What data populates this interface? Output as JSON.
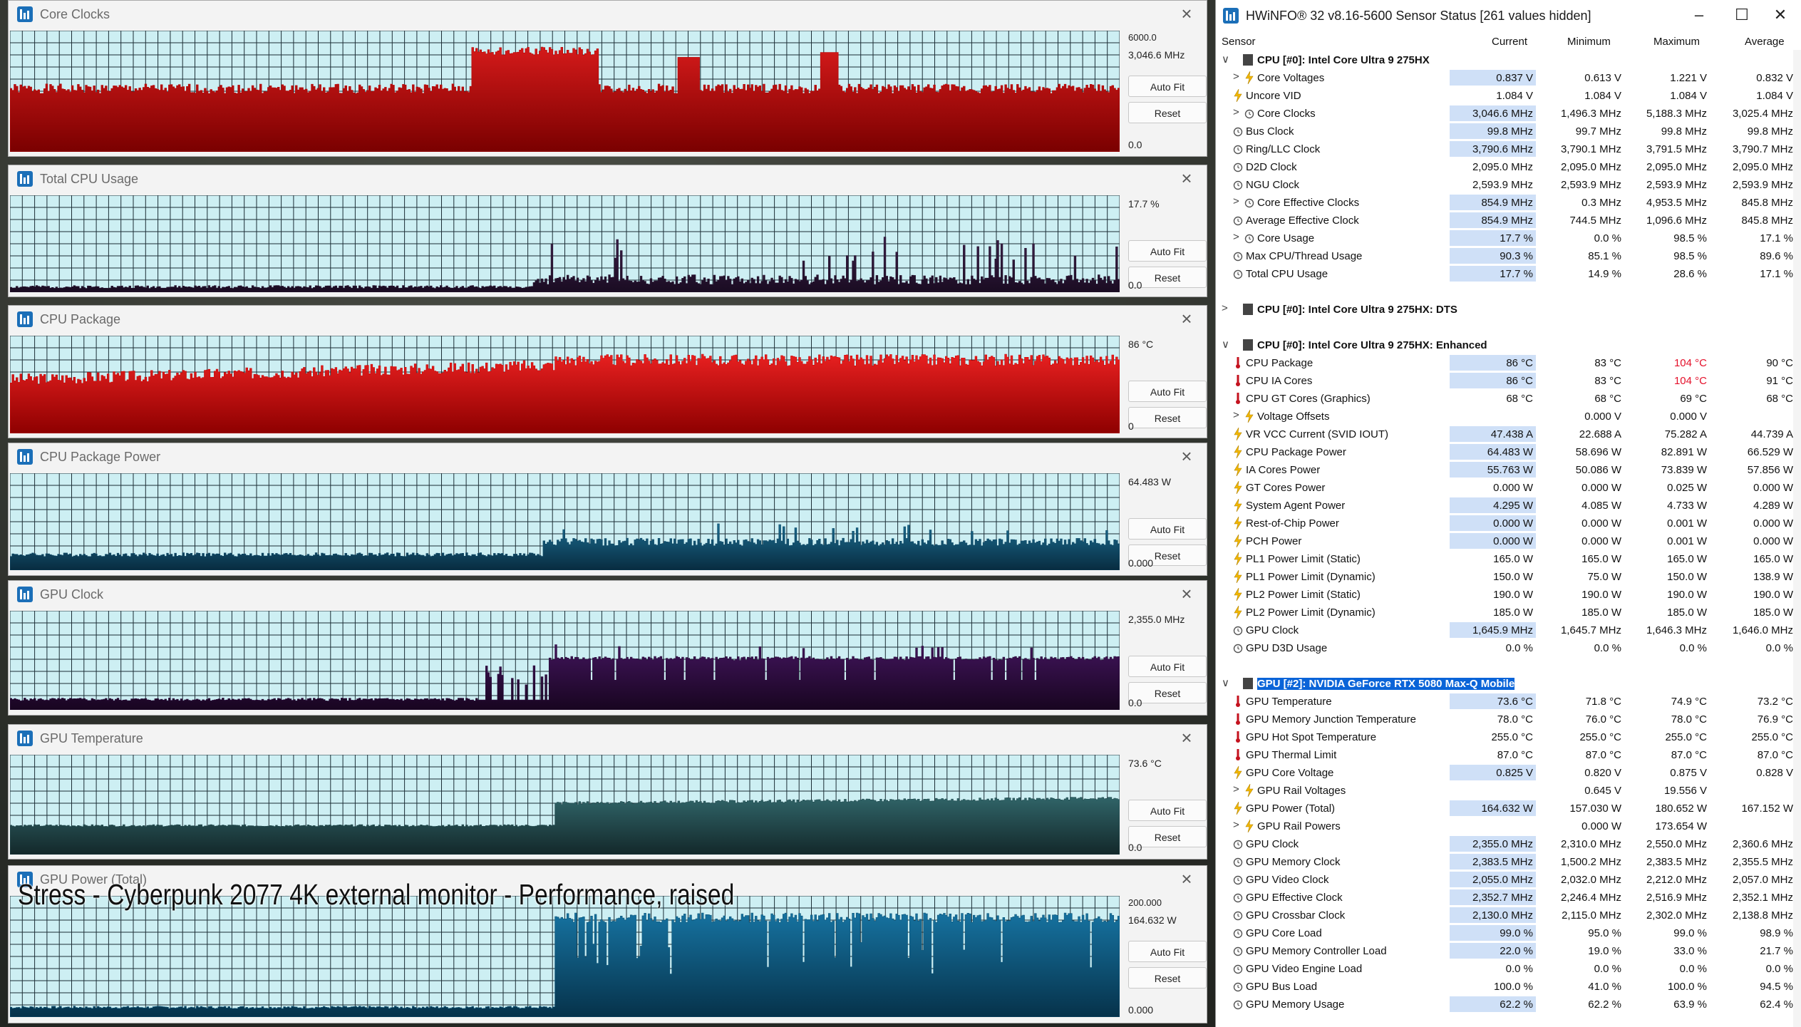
{
  "graphs": [
    {
      "title": "Core Clocks",
      "scale_top": "6000.0",
      "current": "3,046.6 MHz",
      "min": "0.0",
      "colors": [
        "#b80000",
        "#d41a1a",
        "#7a0000"
      ],
      "seed": 1,
      "profile": "clocks"
    },
    {
      "title": "Total CPU Usage",
      "scale_top": "",
      "current": "17.7 %",
      "min": "0.0",
      "colors": [
        "#2a1632",
        "#3a1e48",
        "#1a0c22"
      ],
      "seed": 2,
      "profile": "usage"
    },
    {
      "title": "CPU Package",
      "scale_top": "",
      "current": "86 °C",
      "min": "0",
      "colors": [
        "#d10000",
        "#e82020",
        "#8e0000"
      ],
      "seed": 3,
      "profile": "temp"
    },
    {
      "title": "CPU Package Power",
      "scale_top": "",
      "current": "64.483 W",
      "min": "0.000",
      "colors": [
        "#0f4a68",
        "#1a6a8e",
        "#082c40"
      ],
      "seed": 4,
      "profile": "power"
    },
    {
      "title": "GPU Clock",
      "scale_top": "",
      "current": "2,355.0 MHz",
      "min": "0.0",
      "colors": [
        "#2c0c3c",
        "#40145a",
        "#180520"
      ],
      "seed": 5,
      "profile": "gpuclock"
    },
    {
      "title": "GPU Temperature",
      "scale_top": "",
      "current": "73.6 °C",
      "min": "0.0",
      "colors": [
        "#234c50",
        "#306468",
        "#13282a"
      ],
      "seed": 6,
      "profile": "gputemp"
    },
    {
      "title": "GPU Power (Total)",
      "scale_top": "200.000",
      "current": "164.632 W",
      "min": "0.000",
      "colors": [
        "#0b5478",
        "#1672a0",
        "#06324a"
      ],
      "seed": 7,
      "profile": "gpupower"
    }
  ],
  "buttons": {
    "autofit": "Auto Fit",
    "reset": "Reset"
  },
  "caption": "Stress - Cyberpunk 2077 4K external monitor - Performance, raised",
  "sensor_window": {
    "title": "HWiNFO® 32 v8.16-5600 Sensor Status [261 values hidden]",
    "columns": [
      "Sensor",
      "Current",
      "Minimum",
      "Maximum",
      "Average"
    ],
    "rows": [
      {
        "type": "group",
        "name": "CPU [#0]: Intel Core Ultra 9 275HX",
        "expanded": true
      },
      {
        "type": "item",
        "icon": "bolt",
        "sub": true,
        "name": "Core Voltages",
        "cur": "0.837 V",
        "min": "0.613 V",
        "max": "1.221 V",
        "avg": "0.832 V",
        "hl": true
      },
      {
        "type": "item",
        "icon": "bolt",
        "name": "Uncore VID",
        "cur": "1.084 V",
        "min": "1.084 V",
        "max": "1.084 V",
        "avg": "1.084 V"
      },
      {
        "type": "item",
        "icon": "clock",
        "sub": true,
        "name": "Core Clocks",
        "cur": "3,046.6 MHz",
        "min": "1,496.3 MHz",
        "max": "5,188.3 MHz",
        "avg": "3,025.4 MHz",
        "hl": true
      },
      {
        "type": "item",
        "icon": "clock",
        "name": "Bus Clock",
        "cur": "99.8 MHz",
        "min": "99.7 MHz",
        "max": "99.8 MHz",
        "avg": "99.8 MHz",
        "hl": true
      },
      {
        "type": "item",
        "icon": "clock",
        "name": "Ring/LLC Clock",
        "cur": "3,790.6 MHz",
        "min": "3,790.1 MHz",
        "max": "3,791.5 MHz",
        "avg": "3,790.7 MHz",
        "hl": true
      },
      {
        "type": "item",
        "icon": "clock",
        "name": "D2D Clock",
        "cur": "2,095.0 MHz",
        "min": "2,095.0 MHz",
        "max": "2,095.0 MHz",
        "avg": "2,095.0 MHz"
      },
      {
        "type": "item",
        "icon": "clock",
        "name": "NGU Clock",
        "cur": "2,593.9 MHz",
        "min": "2,593.9 MHz",
        "max": "2,593.9 MHz",
        "avg": "2,593.9 MHz"
      },
      {
        "type": "item",
        "icon": "clock",
        "sub": true,
        "name": "Core Effective Clocks",
        "cur": "854.9 MHz",
        "min": "0.3 MHz",
        "max": "4,953.5 MHz",
        "avg": "845.8 MHz",
        "hl": true
      },
      {
        "type": "item",
        "icon": "clock",
        "name": "Average Effective Clock",
        "cur": "854.9 MHz",
        "min": "744.5 MHz",
        "max": "1,096.6 MHz",
        "avg": "845.8 MHz",
        "hl": true
      },
      {
        "type": "item",
        "icon": "clock",
        "sub": true,
        "name": "Core Usage",
        "cur": "17.7 %",
        "min": "0.0 %",
        "max": "98.5 %",
        "avg": "17.1 %",
        "hl": true
      },
      {
        "type": "item",
        "icon": "clock",
        "name": "Max CPU/Thread Usage",
        "cur": "90.3 %",
        "min": "85.1 %",
        "max": "98.5 %",
        "avg": "89.6 %",
        "hl": true
      },
      {
        "type": "item",
        "icon": "clock",
        "name": "Total CPU Usage",
        "cur": "17.7 %",
        "min": "14.9 %",
        "max": "28.6 %",
        "avg": "17.1 %",
        "hl": true
      },
      {
        "type": "spacer"
      },
      {
        "type": "group",
        "name": "CPU [#0]: Intel Core Ultra 9 275HX: DTS",
        "expanded": false
      },
      {
        "type": "spacer"
      },
      {
        "type": "group",
        "name": "CPU [#0]: Intel Core Ultra 9 275HX: Enhanced",
        "expanded": true
      },
      {
        "type": "item",
        "icon": "therm",
        "name": "CPU Package",
        "cur": "86 °C",
        "min": "83 °C",
        "max": "104 °C",
        "avg": "90 °C",
        "hl": true,
        "maxred": true
      },
      {
        "type": "item",
        "icon": "therm",
        "name": "CPU IA Cores",
        "cur": "86 °C",
        "min": "83 °C",
        "max": "104 °C",
        "avg": "91 °C",
        "hl": true,
        "maxred": true
      },
      {
        "type": "item",
        "icon": "therm",
        "name": "CPU GT Cores (Graphics)",
        "cur": "68 °C",
        "min": "68 °C",
        "max": "69 °C",
        "avg": "68 °C"
      },
      {
        "type": "item",
        "icon": "bolt",
        "sub": true,
        "name": "Voltage Offsets",
        "cur": "",
        "min": "0.000 V",
        "max": "0.000 V",
        "avg": ""
      },
      {
        "type": "item",
        "icon": "bolt",
        "name": "VR VCC Current (SVID IOUT)",
        "cur": "47.438 A",
        "min": "22.688 A",
        "max": "75.282 A",
        "avg": "44.739 A",
        "hl": true
      },
      {
        "type": "item",
        "icon": "bolt",
        "name": "CPU Package Power",
        "cur": "64.483 W",
        "min": "58.696 W",
        "max": "82.891 W",
        "avg": "66.529 W",
        "hl": true
      },
      {
        "type": "item",
        "icon": "bolt",
        "name": "IA Cores Power",
        "cur": "55.763 W",
        "min": "50.086 W",
        "max": "73.839 W",
        "avg": "57.856 W",
        "hl": true
      },
      {
        "type": "item",
        "icon": "bolt",
        "name": "GT Cores Power",
        "cur": "0.000 W",
        "min": "0.000 W",
        "max": "0.025 W",
        "avg": "0.000 W"
      },
      {
        "type": "item",
        "icon": "bolt",
        "name": "System Agent Power",
        "cur": "4.295 W",
        "min": "4.085 W",
        "max": "4.733 W",
        "avg": "4.289 W",
        "hl": true
      },
      {
        "type": "item",
        "icon": "bolt",
        "name": "Rest-of-Chip Power",
        "cur": "0.000 W",
        "min": "0.000 W",
        "max": "0.001 W",
        "avg": "0.000 W",
        "hl": true
      },
      {
        "type": "item",
        "icon": "bolt",
        "name": "PCH Power",
        "cur": "0.000 W",
        "min": "0.000 W",
        "max": "0.001 W",
        "avg": "0.000 W",
        "hl": true
      },
      {
        "type": "item",
        "icon": "bolt",
        "name": "PL1 Power Limit (Static)",
        "cur": "165.0 W",
        "min": "165.0 W",
        "max": "165.0 W",
        "avg": "165.0 W"
      },
      {
        "type": "item",
        "icon": "bolt",
        "name": "PL1 Power Limit (Dynamic)",
        "cur": "150.0 W",
        "min": "75.0 W",
        "max": "150.0 W",
        "avg": "138.9 W"
      },
      {
        "type": "item",
        "icon": "bolt",
        "name": "PL2 Power Limit (Static)",
        "cur": "190.0 W",
        "min": "190.0 W",
        "max": "190.0 W",
        "avg": "190.0 W"
      },
      {
        "type": "item",
        "icon": "bolt",
        "name": "PL2 Power Limit (Dynamic)",
        "cur": "185.0 W",
        "min": "185.0 W",
        "max": "185.0 W",
        "avg": "185.0 W"
      },
      {
        "type": "item",
        "icon": "clock",
        "name": "GPU Clock",
        "cur": "1,645.9 MHz",
        "min": "1,645.7 MHz",
        "max": "1,646.3 MHz",
        "avg": "1,646.0 MHz",
        "hl": true
      },
      {
        "type": "item",
        "icon": "clock",
        "name": "GPU D3D Usage",
        "cur": "0.0 %",
        "min": "0.0 %",
        "max": "0.0 %",
        "avg": "0.0 %"
      },
      {
        "type": "spacer"
      },
      {
        "type": "group",
        "name": "GPU [#2]: NVIDIA  GeForce RTX 5080 Max-Q Mobile",
        "expanded": true,
        "selected": true
      },
      {
        "type": "item",
        "icon": "therm",
        "name": "GPU Temperature",
        "cur": "73.6 °C",
        "min": "71.8 °C",
        "max": "74.9 °C",
        "avg": "73.2 °C",
        "hl": true
      },
      {
        "type": "item",
        "icon": "therm",
        "name": "GPU Memory Junction Temperature",
        "cur": "78.0 °C",
        "min": "76.0 °C",
        "max": "78.0 °C",
        "avg": "76.9 °C"
      },
      {
        "type": "item",
        "icon": "therm",
        "name": "GPU Hot Spot Temperature",
        "cur": "255.0 °C",
        "min": "255.0 °C",
        "max": "255.0 °C",
        "avg": "255.0 °C"
      },
      {
        "type": "item",
        "icon": "therm",
        "name": "GPU Thermal Limit",
        "cur": "87.0 °C",
        "min": "87.0 °C",
        "max": "87.0 °C",
        "avg": "87.0 °C"
      },
      {
        "type": "item",
        "icon": "bolt",
        "name": "GPU Core Voltage",
        "cur": "0.825 V",
        "min": "0.820 V",
        "max": "0.875 V",
        "avg": "0.828 V",
        "hl": true
      },
      {
        "type": "item",
        "icon": "bolt",
        "sub": true,
        "name": "GPU Rail Voltages",
        "cur": "",
        "min": "0.645 V",
        "max": "19.556 V",
        "avg": ""
      },
      {
        "type": "item",
        "icon": "bolt",
        "name": "GPU Power (Total)",
        "cur": "164.632 W",
        "min": "157.030 W",
        "max": "180.652 W",
        "avg": "167.152 W",
        "hl": true
      },
      {
        "type": "item",
        "icon": "bolt",
        "sub": true,
        "name": "GPU Rail Powers",
        "cur": "",
        "min": "0.000 W",
        "max": "173.654 W",
        "avg": ""
      },
      {
        "type": "item",
        "icon": "clock",
        "name": "GPU Clock",
        "cur": "2,355.0 MHz",
        "min": "2,310.0 MHz",
        "max": "2,550.0 MHz",
        "avg": "2,360.6 MHz",
        "hl": true
      },
      {
        "type": "item",
        "icon": "clock",
        "name": "GPU Memory Clock",
        "cur": "2,383.5 MHz",
        "min": "1,500.2 MHz",
        "max": "2,383.5 MHz",
        "avg": "2,355.5 MHz",
        "hl": true
      },
      {
        "type": "item",
        "icon": "clock",
        "name": "GPU Video Clock",
        "cur": "2,055.0 MHz",
        "min": "2,032.0 MHz",
        "max": "2,212.0 MHz",
        "avg": "2,057.0 MHz",
        "hl": true
      },
      {
        "type": "item",
        "icon": "clock",
        "name": "GPU Effective Clock",
        "cur": "2,352.7 MHz",
        "min": "2,246.4 MHz",
        "max": "2,516.9 MHz",
        "avg": "2,352.1 MHz",
        "hl": true
      },
      {
        "type": "item",
        "icon": "clock",
        "name": "GPU Crossbar Clock",
        "cur": "2,130.0 MHz",
        "min": "2,115.0 MHz",
        "max": "2,302.0 MHz",
        "avg": "2,138.8 MHz",
        "hl": true
      },
      {
        "type": "item",
        "icon": "clock",
        "name": "GPU Core Load",
        "cur": "99.0 %",
        "min": "95.0 %",
        "max": "99.0 %",
        "avg": "98.9 %",
        "hl": true
      },
      {
        "type": "item",
        "icon": "clock",
        "name": "GPU Memory Controller Load",
        "cur": "22.0 %",
        "min": "19.0 %",
        "max": "33.0 %",
        "avg": "21.7 %",
        "hl": true
      },
      {
        "type": "item",
        "icon": "clock",
        "name": "GPU Video Engine Load",
        "cur": "0.0 %",
        "min": "0.0 %",
        "max": "0.0 %",
        "avg": "0.0 %"
      },
      {
        "type": "item",
        "icon": "clock",
        "name": "GPU Bus Load",
        "cur": "100.0 %",
        "min": "41.0 %",
        "max": "100.0 %",
        "avg": "94.5 %"
      },
      {
        "type": "item",
        "icon": "clock",
        "name": "GPU Memory Usage",
        "cur": "62.2 %",
        "min": "62.2 %",
        "max": "63.9 %",
        "avg": "62.4 %",
        "hl": true
      }
    ]
  }
}
